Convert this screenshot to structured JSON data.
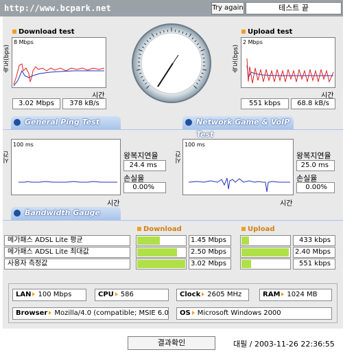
{
  "header": {
    "url": "http://www.bcpark.net",
    "try_again": "Try again",
    "test_name": "테스트 끝"
  },
  "download": {
    "title": "Download test",
    "ylabel": "속도(bps)",
    "scale": "8 Mbps",
    "xlabel": "시간",
    "mbps": "3.02 Mbps",
    "kbs": "378 kB/s"
  },
  "upload": {
    "title": "Upload test",
    "ylabel": "속도(bps)",
    "scale": "2 Mbps",
    "xlabel": "시간",
    "kbps": "551 kbps",
    "kbs": "68.8 kB/s"
  },
  "tabs": {
    "ping": "General Ping Test",
    "game": "Network Game & VoIP Test",
    "gauge": "Bandwidth Gauge"
  },
  "ping_left": {
    "ylabel": "시간(ms)",
    "scale": "100 ms",
    "xlabel": "시간",
    "rtt_label": "왕복지연율",
    "rtt_value": "24.4 ms",
    "loss_label": "손실율",
    "loss_value": "0.00%"
  },
  "ping_right": {
    "ylabel": "시간(ms)",
    "scale": "100 ms",
    "xlabel": "시간",
    "rtt_label": "왕복지연율",
    "rtt_value": "25.0 ms",
    "loss_label": "손실율",
    "loss_value": "0.00%"
  },
  "gauge": {
    "download_label": "Download",
    "upload_label": "Upload",
    "rows": [
      {
        "label": "메가패스 ADSL Lite 평균",
        "dl": "1.45 Mbps",
        "dl_pct": 0.48,
        "ul": "433 kbps",
        "ul_pct": 0.18
      },
      {
        "label": "메가패스 ADSL Lite 최대값",
        "dl": "2.50 Mbps",
        "dl_pct": 0.83,
        "ul": "2.40 Mbps",
        "ul_pct": 0.98
      },
      {
        "label": "사용자 측정값",
        "dl": "3.02 Mbps",
        "dl_pct": 1.0,
        "ul": "551 kbps",
        "ul_pct": 0.22
      }
    ]
  },
  "system": {
    "lan_label": "LAN",
    "lan_value": "100 Mbps",
    "cpu_label": "CPU",
    "cpu_value": "586",
    "clock_label": "Clock",
    "clock_value": "2605 MHz",
    "ram_label": "RAM",
    "ram_value": "1024 MB",
    "browser_label": "Browser",
    "browser_value": "Mozilla/4.0 (compatible; MSIE 6.0",
    "os_label": "OS",
    "os_value": "Microsoft Windows 2000"
  },
  "footer": {
    "confirm": "결과확인",
    "timestamp": "대필 / 2003-11-26 22:36:55"
  },
  "colors": {
    "bar_green": "#b0e048",
    "accent_orange": "#f0a020",
    "tab_blue": "#a9c4ea"
  }
}
